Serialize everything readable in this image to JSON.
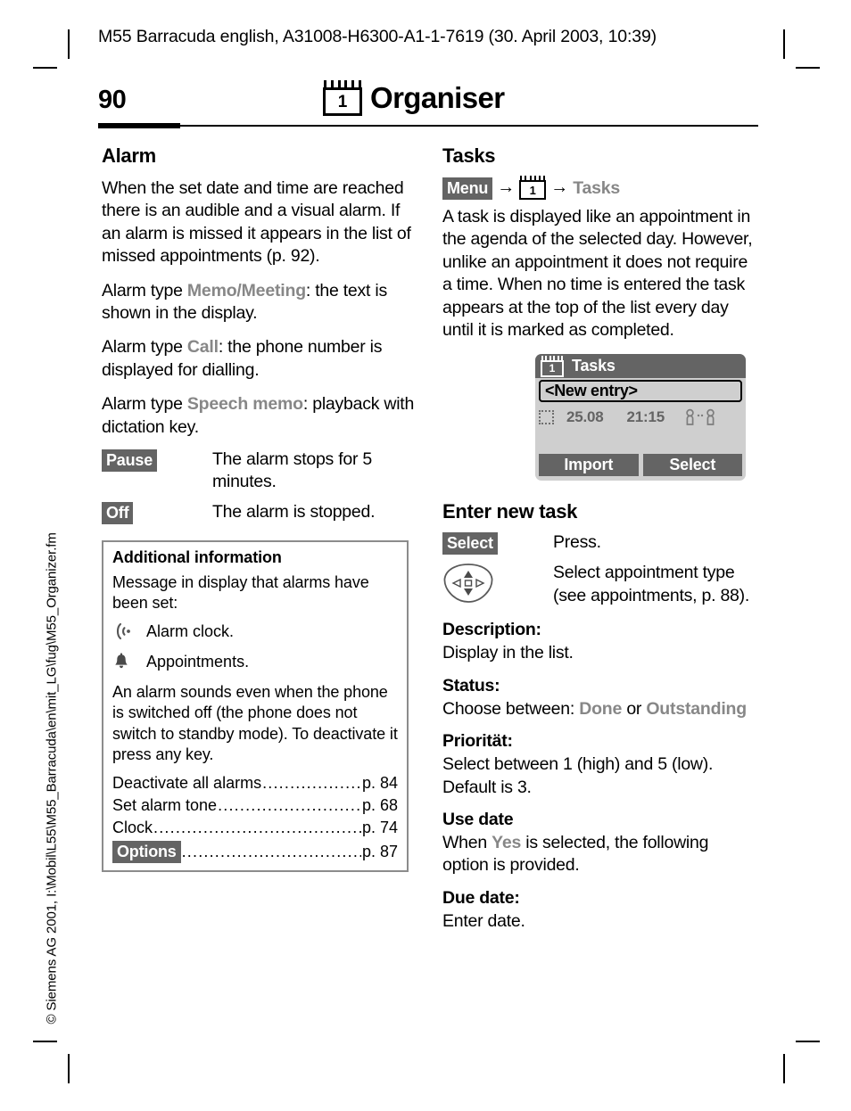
{
  "document": {
    "header": "M55 Barracuda english, A31008-H6300-A1-1-7619 (30. April 2003, 10:39)",
    "side_caption": "© Siemens AG 2001, I:\\Mobil\\L55\\M55_Barracuda\\en\\mit_LG\\fug\\M55_Organizer.fm",
    "page_number": "90",
    "chapter_title": "Organiser",
    "chapter_icon_digit": "1"
  },
  "left_column": {
    "section_title": "Alarm",
    "paragraphs": [
      "When the set date and time are reached there is an audible and a visual alarm. If an alarm is missed it appears in the list of missed appointments (p. 92)."
    ],
    "alarm_types": [
      {
        "prefix": "Alarm type ",
        "term": "Memo/Meeting",
        "suffix": ": the text is shown in the display."
      },
      {
        "prefix": "Alarm type ",
        "term": "Call",
        "suffix": ": the phone number is displayed for dialling."
      },
      {
        "prefix": "Alarm type ",
        "term": "Speech memo",
        "suffix": ": playback with dictation key."
      }
    ],
    "key_rows": [
      {
        "key": "Pause",
        "description": "The alarm stops for 5 minutes."
      },
      {
        "key": "Off",
        "description": "The alarm is stopped."
      }
    ],
    "info_box": {
      "title": "Additional information",
      "intro": "Message in display that alarms have been set:",
      "icon_rows": [
        {
          "icon": "alarm-clock-icon",
          "text": "Alarm clock."
        },
        {
          "icon": "bell-icon",
          "text": "Appointments."
        }
      ],
      "note": "An alarm sounds even when the phone is switched off (the phone does not switch to standby mode). To deactivate it press any key.",
      "references": [
        {
          "label": "Deactivate all alarms",
          "page": "p. 84",
          "is_key": false
        },
        {
          "label": "Set alarm tone",
          "page": "p. 68",
          "is_key": false
        },
        {
          "label": "Clock",
          "page": "p. 74",
          "is_key": false
        },
        {
          "label": "Options",
          "page": "p. 87",
          "is_key": true
        }
      ]
    }
  },
  "right_column": {
    "section_title": "Tasks",
    "nav_path": {
      "key_label": "Menu",
      "icon_digit": "1",
      "destination": "Tasks",
      "arrow": "→"
    },
    "intro": "A task is displayed like an appointment in the agenda of the selected day. However, unlike an appointment it does not require a time. When no time is entered the task appears at the top of the list every day until it is marked as completed.",
    "phone_display": {
      "title": "Tasks",
      "title_icon_digit": "1",
      "new_entry": "<New entry>",
      "row": {
        "status_icon": "empty-dotted-checkbox-icon",
        "date": "25.08",
        "time": "21:15",
        "people_icon": "two-people-icon"
      },
      "softkey_left": "Import",
      "softkey_right": "Select"
    },
    "enter_new_task": {
      "heading": "Enter new task",
      "rows": [
        {
          "key": "Select",
          "key_type": "softkey",
          "description": "Press."
        },
        {
          "key": "navigation-key-icon",
          "key_type": "icon",
          "description": "Select appointment type (see appointments, p. 88)."
        }
      ]
    },
    "fields": [
      {
        "heading": "Description:",
        "text": "Display in the list."
      },
      {
        "heading": "Status:",
        "text_prefix": "Choose between: ",
        "term1": "Done",
        "text_middle": " or ",
        "term2": "Outstanding",
        "text_suffix": ""
      },
      {
        "heading": "Priorität:",
        "text": "Select between 1 (high) and 5 (low). Default is 3."
      },
      {
        "heading": "Use date",
        "text_prefix": "When ",
        "term1": "Yes",
        "text_suffix": " is selected, the following option is provided."
      },
      {
        "heading": "Due date:",
        "text": "Enter date."
      }
    ]
  }
}
